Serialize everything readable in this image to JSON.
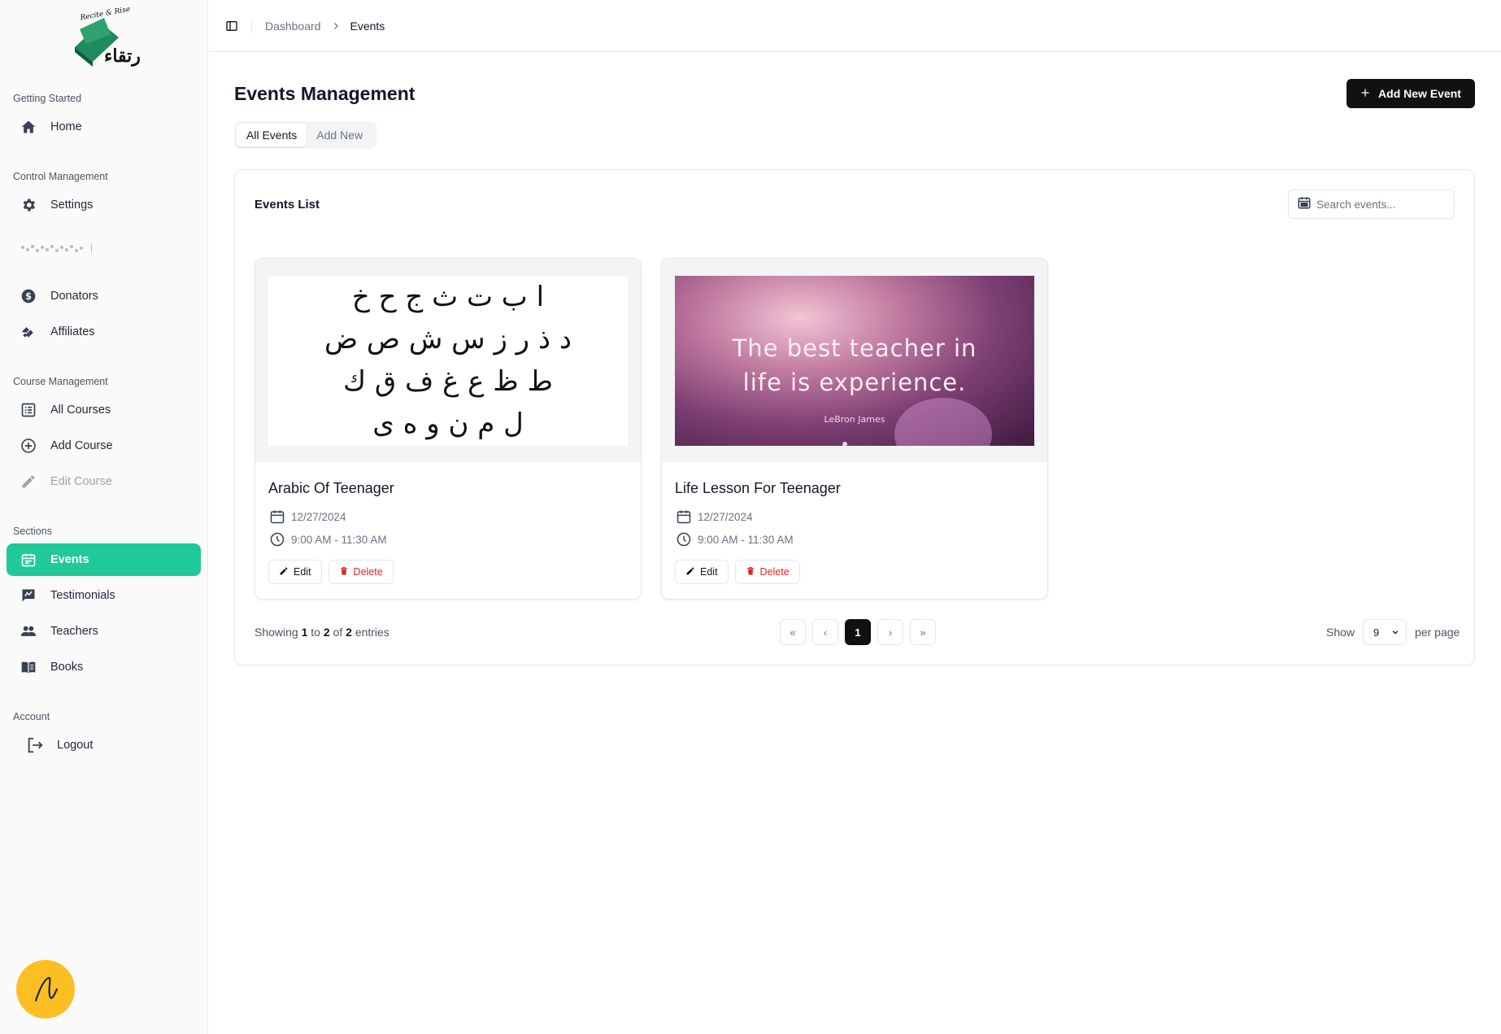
{
  "sidebar": {
    "logo_text": "Recite & Rise",
    "groups": [
      {
        "label": "Getting Started",
        "items": [
          {
            "label": "Home",
            "icon": "home-icon"
          }
        ]
      },
      {
        "label": "Control Management",
        "items": [
          {
            "label": "Settings",
            "icon": "gear-icon"
          },
          {
            "label": "Donators",
            "icon": "dollar-icon"
          },
          {
            "label": "Affiliates",
            "icon": "handshake-icon"
          }
        ]
      },
      {
        "label": "Course Management",
        "items": [
          {
            "label": "All Courses",
            "icon": "list-icon"
          },
          {
            "label": "Add Course",
            "icon": "plus-circle-icon"
          },
          {
            "label": "Edit Course",
            "icon": "pencil-icon"
          }
        ]
      },
      {
        "label": "Sections",
        "items": [
          {
            "label": "Events",
            "icon": "calendar-icon"
          },
          {
            "label": "Testimonials",
            "icon": "testimonial-icon"
          },
          {
            "label": "Teachers",
            "icon": "users-icon"
          },
          {
            "label": "Books",
            "icon": "book-icon"
          }
        ]
      },
      {
        "label": "Account",
        "items": [
          {
            "label": "Logout",
            "icon": "logout-icon"
          }
        ]
      }
    ],
    "active_item": "Events",
    "accent_color": "#20c997"
  },
  "breadcrumb": {
    "items": [
      "Dashboard",
      "Events"
    ]
  },
  "page": {
    "title": "Events Management",
    "add_button_label": "Add New Event",
    "tabs": [
      {
        "label": "All Events",
        "active": true
      },
      {
        "label": "Add New",
        "active": false
      }
    ]
  },
  "events_panel": {
    "title": "Events List",
    "search_placeholder": "Search events...",
    "cards": [
      {
        "title": "Arabic Of Teenager",
        "date": "12/27/2024",
        "time": "9:00 AM - 11:30 AM",
        "image": {
          "type": "arabic-alphabet",
          "rows": [
            "ا ب ت ث ج ح خ",
            "د ذ ر ز س ش ص ض",
            "ط ظ ع غ ف ق ك",
            "ل م ن و ه ى"
          ]
        },
        "edit_label": "Edit",
        "delete_label": "Delete"
      },
      {
        "title": "Life Lesson For Teenager",
        "date": "12/27/2024",
        "time": "9:00 AM - 11:30 AM",
        "image": {
          "type": "quote",
          "line1": "The best teacher in",
          "line2": "life is experience.",
          "author": "LeBron James"
        },
        "edit_label": "Edit",
        "delete_label": "Delete"
      }
    ],
    "pagination": {
      "showing_prefix": "Showing",
      "from": "1",
      "to_word": "to",
      "to": "2",
      "of_word": "of",
      "total": "2",
      "entries_word": "entries",
      "current_page": "1",
      "first": "«",
      "prev": "‹",
      "next": "›",
      "last": "»",
      "show_label": "Show",
      "per_page_value": "9",
      "per_page_label": "per page"
    }
  }
}
